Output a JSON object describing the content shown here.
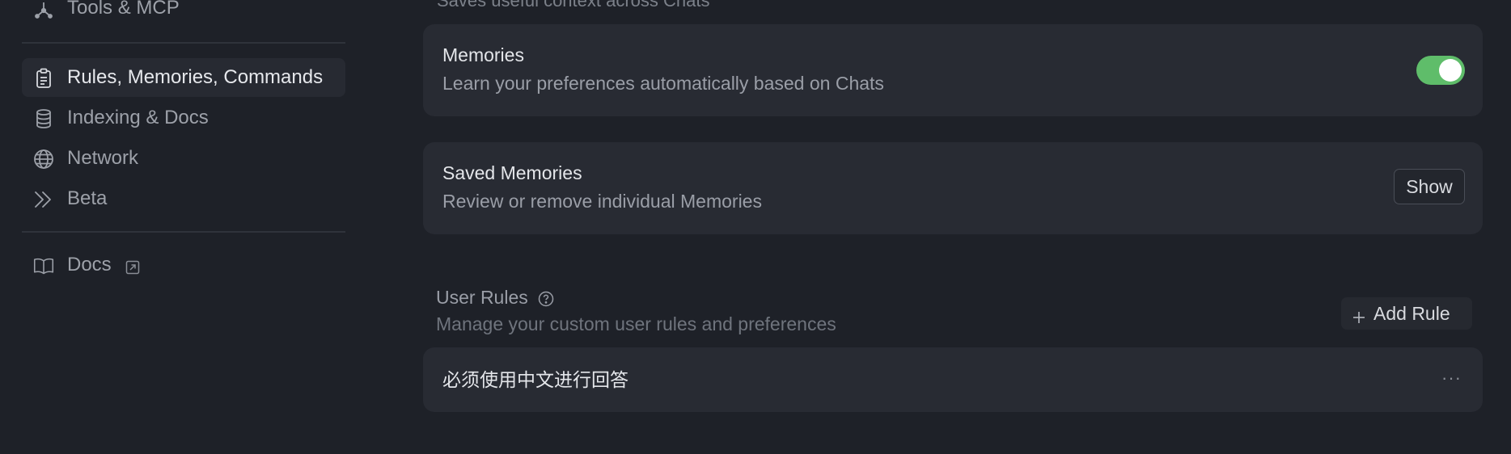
{
  "sidebar": {
    "items": [
      {
        "label": "Tools & MCP",
        "icon": "network-nodes-icon"
      },
      {
        "label": "Rules, Memories, Commands",
        "icon": "clipboard-icon",
        "active": true
      },
      {
        "label": "Indexing & Docs",
        "icon": "database-icon"
      },
      {
        "label": "Network",
        "icon": "globe-icon"
      },
      {
        "label": "Beta",
        "icon": "double-chevron-right-icon"
      },
      {
        "label": "Docs",
        "icon": "book-icon",
        "external": true
      }
    ]
  },
  "main": {
    "top_cut_text": "Saves useful context across Chats",
    "memories": {
      "title": "Memories",
      "description": "Learn your preferences automatically based on Chats",
      "toggle_on": true
    },
    "saved_memories": {
      "title": "Saved Memories",
      "description": "Review or remove individual Memories",
      "button_label": "Show"
    },
    "user_rules": {
      "title": "User Rules",
      "description": "Manage your custom user rules and preferences",
      "add_label": "Add Rule",
      "rules": [
        {
          "text": "必须使用中文进行回答",
          "menu": "···"
        }
      ]
    }
  },
  "colors": {
    "background": "#1e2128",
    "card": "#282b33",
    "toggle_on": "#5fbd6a"
  }
}
